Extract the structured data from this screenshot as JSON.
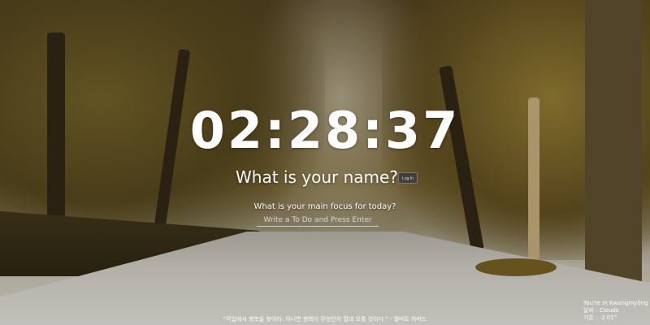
{
  "clock": {
    "time": "02:28:37"
  },
  "greeting": {
    "question": "What is your name?",
    "login_label": "Log In"
  },
  "todo": {
    "question": "What is your main focus for today?",
    "placeholder": "Write a To Do and Press Enter"
  },
  "quote": {
    "text": "\"직업에서 행복을 찾아라. 아니면 행복이 무엇인지 절대 모를 것이다.\" - 엘버트 허버드"
  },
  "weather": {
    "location": "You're in Kwangmyŏng",
    "condition_label": "날씨 :",
    "condition": "Clouds",
    "temperature_label": "기온 :",
    "temperature": "-2.01°"
  },
  "colors": {
    "text": "#ffffff",
    "button_bg": "#3c3c3c"
  }
}
